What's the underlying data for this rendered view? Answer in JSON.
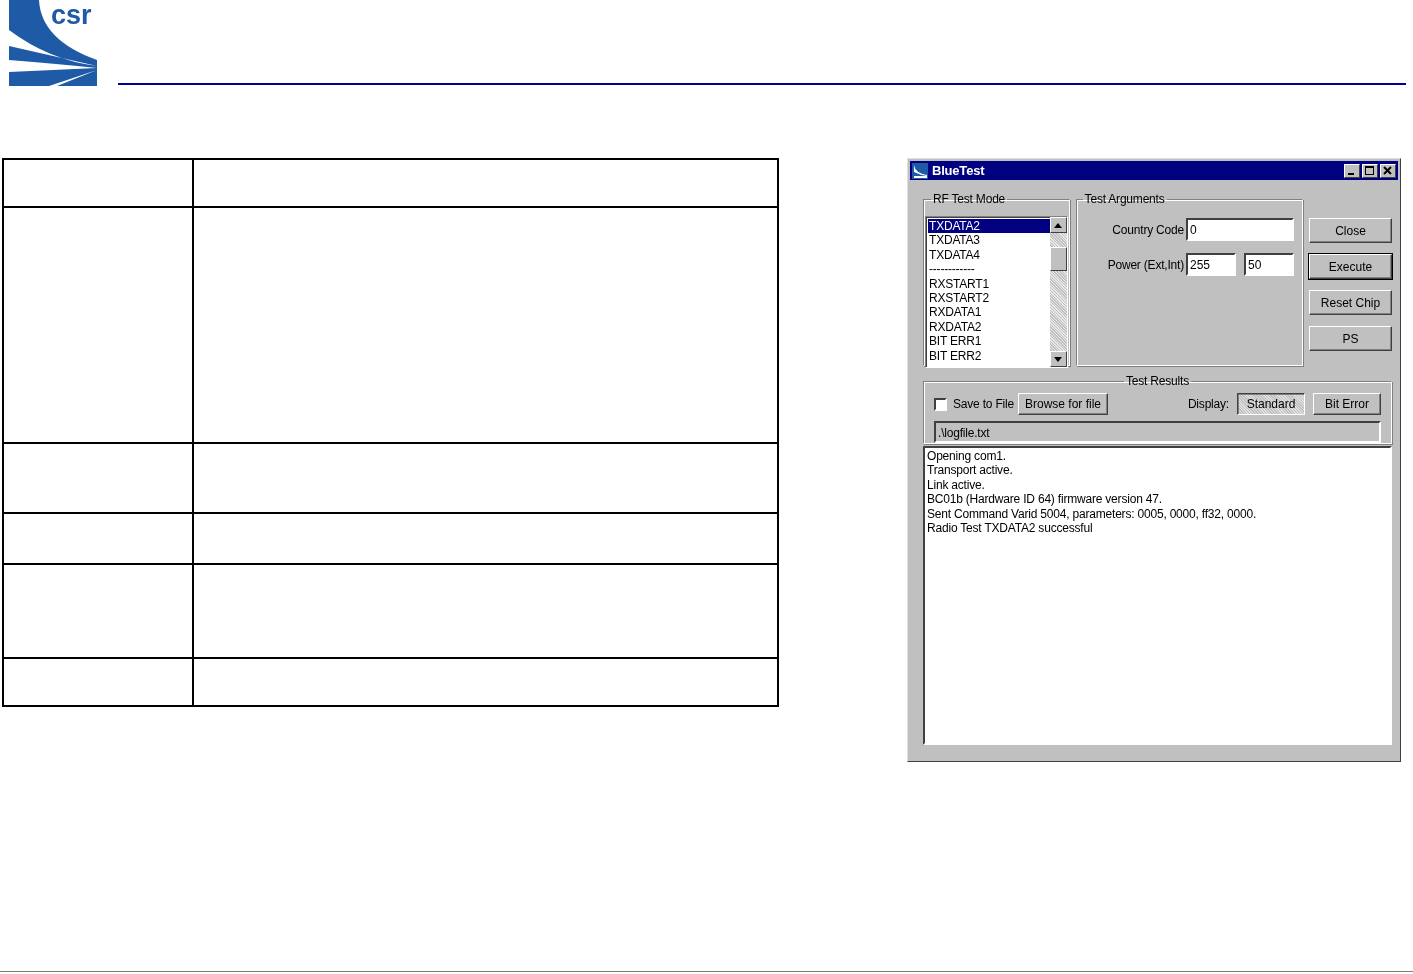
{
  "logo": {
    "text": "csr"
  },
  "window": {
    "title": "BlueTest"
  },
  "rf_test_mode": {
    "label": "RF Test Mode",
    "items": [
      {
        "label": "TXDATA2",
        "selected": true
      },
      {
        "label": "TXDATA3",
        "selected": false
      },
      {
        "label": "TXDATA4",
        "selected": false
      },
      {
        "label": "------------",
        "selected": false
      },
      {
        "label": "RXSTART1",
        "selected": false
      },
      {
        "label": "RXSTART2",
        "selected": false
      },
      {
        "label": "RXDATA1",
        "selected": false
      },
      {
        "label": "RXDATA2",
        "selected": false
      },
      {
        "label": "BIT ERR1",
        "selected": false
      },
      {
        "label": "BIT ERR2",
        "selected": false
      }
    ]
  },
  "test_arguments": {
    "label": "Test Arguments",
    "country_code": {
      "label": "Country Code",
      "value": "0"
    },
    "power": {
      "label": "Power (Ext,Int)",
      "ext": "255",
      "int": "50"
    }
  },
  "buttons": [
    {
      "label": "Close",
      "default": false
    },
    {
      "label": "Execute",
      "default": true
    },
    {
      "label": "Reset Chip",
      "default": false
    },
    {
      "label": "PS",
      "default": false
    }
  ],
  "test_results": {
    "label": "Test Results",
    "save_to_file": {
      "label": "Save to File",
      "checked": false
    },
    "browse_button": "Browse for file",
    "display_label": "Display:",
    "display_options": [
      {
        "label": "Standard",
        "selected": true
      },
      {
        "label": "Bit Error",
        "selected": false
      }
    ],
    "file_path": ".\\logfile.txt",
    "log": [
      "Opening com1.",
      "Transport active.",
      "Link active.",
      "BC01b (Hardware ID 64) firmware version 47.",
      "Sent Command Varid 5004, parameters: 0005, 0000, ff32, 0000.",
      "Radio Test TXDATA2 successful"
    ]
  }
}
